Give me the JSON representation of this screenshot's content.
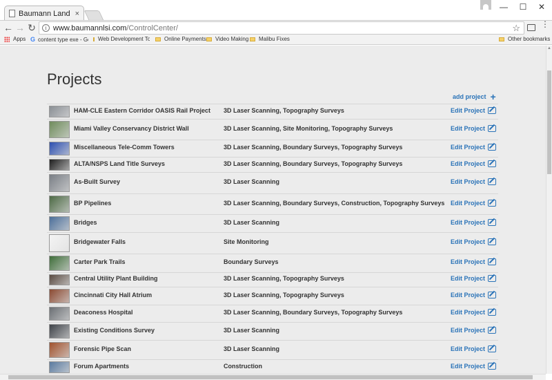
{
  "browser": {
    "tab_title": "Baumann Land Survey In",
    "tab_close": "×",
    "url_host": "www.baumannlsi.com",
    "url_path": "/ControlCenter/",
    "back": "←",
    "forward": "→",
    "reload": "↻",
    "star": "☆",
    "menu": "⋮",
    "minimize": "—",
    "maximize": "☐",
    "close": "✕"
  },
  "bookmarks": {
    "apps": "Apps",
    "google_label": "G",
    "items": [
      "content type exe - Go",
      "Web Development To",
      "Online Payments",
      "Video Making",
      "Malibu Fixes"
    ],
    "other": "Other bookmarks"
  },
  "page": {
    "title": "Projects",
    "add_project": "add project",
    "add_icon": "+",
    "edit_label": "Edit Project"
  },
  "projects": [
    {
      "name": "HAM-CLE Eastern Corridor OASIS Rail Project",
      "categories": "3D Laser Scanning, Topography Surveys",
      "thumb_color": "#8a8f95"
    },
    {
      "name": "Miami Valley Conservancy District Wall",
      "categories": "3D Laser Scanning, Site Monitoring, Topography Surveys",
      "thumb_color": "#6f8c5c"
    },
    {
      "name": "Miscellaneous Tele-Comm Towers",
      "categories": "3D Laser Scanning, Boundary Surveys, Topography Surveys",
      "thumb_color": "#2c4fb0"
    },
    {
      "name": "ALTA/NSPS Land Title Surveys",
      "categories": "3D Laser Scanning, Boundary Surveys, Topography Surveys",
      "thumb_color": "#1d1d1d"
    },
    {
      "name": "As-Built Survey",
      "categories": "3D Laser Scanning",
      "thumb_color": "#7a7f86"
    },
    {
      "name": "BP Pipelines",
      "categories": "3D Laser Scanning, Boundary Surveys, Construction, Topography Surveys",
      "thumb_color": "#4d6a45"
    },
    {
      "name": "Bridges",
      "categories": "3D Laser Scanning",
      "thumb_color": "#4c6f9a"
    },
    {
      "name": "Bridgewater Falls",
      "categories": "Site Monitoring",
      "thumb_color": "#f4f4f4"
    },
    {
      "name": "Carter Park Trails",
      "categories": "Boundary Surveys",
      "thumb_color": "#3f6e3a"
    },
    {
      "name": "Central Utility Plant Building",
      "categories": "3D Laser Scanning, Topography Surveys",
      "thumb_color": "#5a4b42"
    },
    {
      "name": "Cincinnati City Hall Atrium",
      "categories": "3D Laser Scanning, Topography Surveys",
      "thumb_color": "#8b4a32"
    },
    {
      "name": "Deaconess Hospital",
      "categories": "3D Laser Scanning, Boundary Surveys, Topography Surveys",
      "thumb_color": "#6b6f74"
    },
    {
      "name": "Existing Conditions Survey",
      "categories": "3D Laser Scanning",
      "thumb_color": "#3f4349"
    },
    {
      "name": "Forensic Pipe Scan",
      "categories": "3D Laser Scanning",
      "thumb_color": "#a0522d"
    },
    {
      "name": "Forum Apartments",
      "categories": "Construction",
      "thumb_color": "#5b7ba0"
    }
  ]
}
